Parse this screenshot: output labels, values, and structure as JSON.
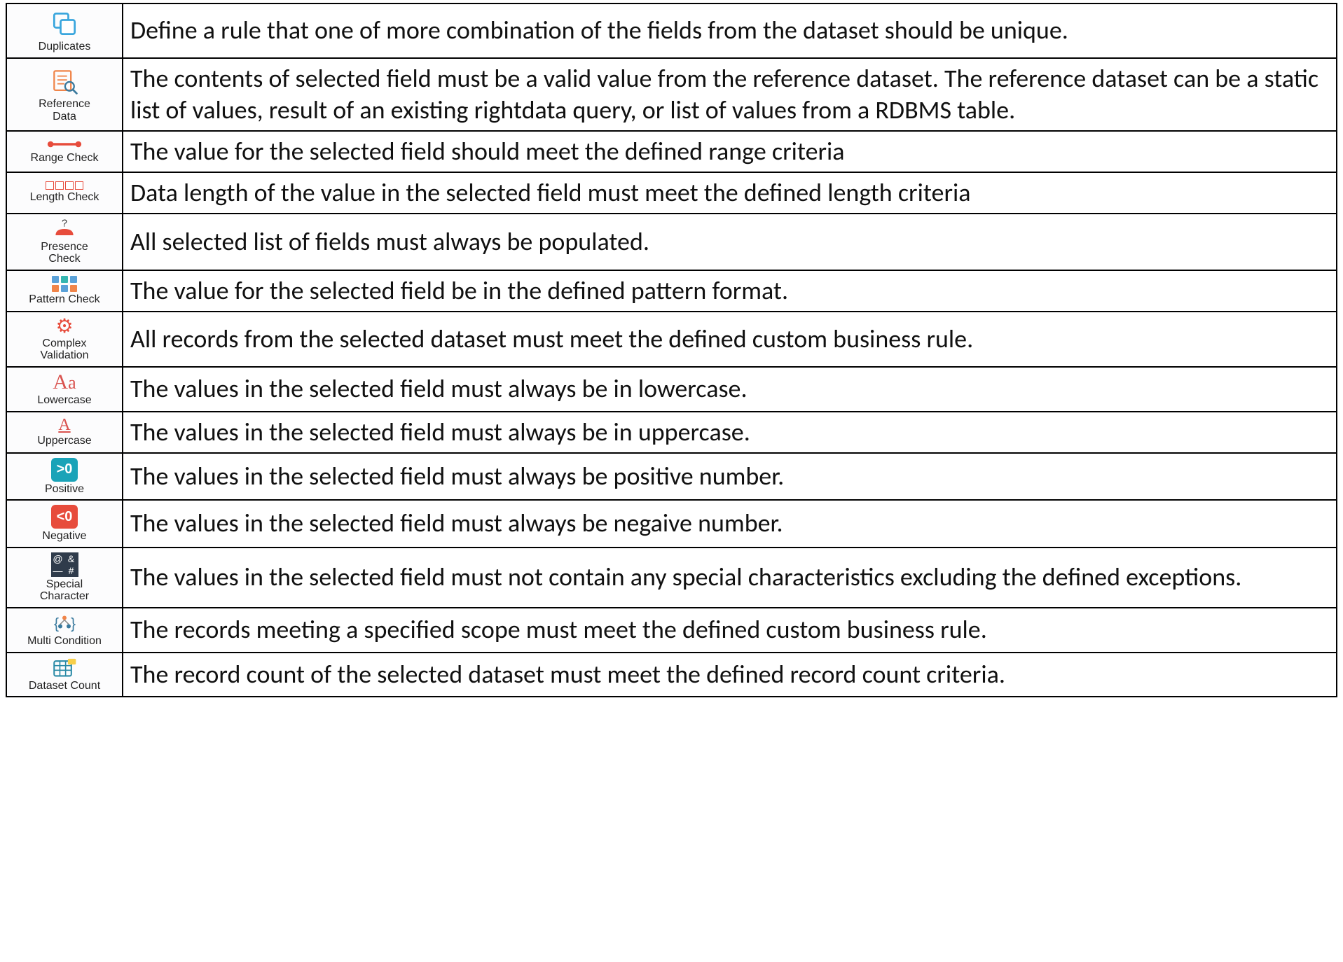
{
  "rules": [
    {
      "id": "duplicates",
      "label": "Duplicates",
      "description": "Define a rule that one of more combination of the fields from the dataset should be unique."
    },
    {
      "id": "reference-data",
      "label": "Reference\nData",
      "description": "The contents of selected field must be a valid value from the reference dataset. The reference dataset can be a static list of values, result of an existing rightdata query, or list of values from a RDBMS table."
    },
    {
      "id": "range-check",
      "label": "Range Check",
      "description": "The value for the selected field should meet the defined range criteria"
    },
    {
      "id": "length-check",
      "label": "Length Check",
      "description": "Data length of the value in the selected field must meet the defined length criteria"
    },
    {
      "id": "presence-check",
      "label": "Presence\nCheck",
      "description": "All selected list of fields must always be populated."
    },
    {
      "id": "pattern-check",
      "label": "Pattern Check",
      "description": "The value for the selected field be in the defined pattern format."
    },
    {
      "id": "complex-validation",
      "label": "Complex\nValidation",
      "description": "All records from the selected dataset must meet the defined custom business rule."
    },
    {
      "id": "lowercase",
      "label": "Lowercase",
      "description": "The values in the selected field must always be in lowercase."
    },
    {
      "id": "uppercase",
      "label": "Uppercase",
      "description": "The values in the selected field must always be in uppercase."
    },
    {
      "id": "positive",
      "label": "Positive",
      "description": "The values in the selected field must always be positive number."
    },
    {
      "id": "negative",
      "label": "Negative",
      "description": "The values in the selected field must always be negaive number."
    },
    {
      "id": "special-character",
      "label": "Special\nCharacter",
      "description": "The values in the selected field must not contain any special characteristics excluding the defined exceptions."
    },
    {
      "id": "multi-condition",
      "label": "Multi Condition",
      "description": "The records meeting a specified scope must meet the defined custom business rule."
    },
    {
      "id": "dataset-count",
      "label": "Dataset Count",
      "description": "The record count of the selected dataset must meet the defined record count criteria."
    }
  ],
  "badges": {
    "positive": ">0",
    "negative": "<0",
    "special": [
      "@",
      "&",
      "—",
      "#"
    ]
  }
}
